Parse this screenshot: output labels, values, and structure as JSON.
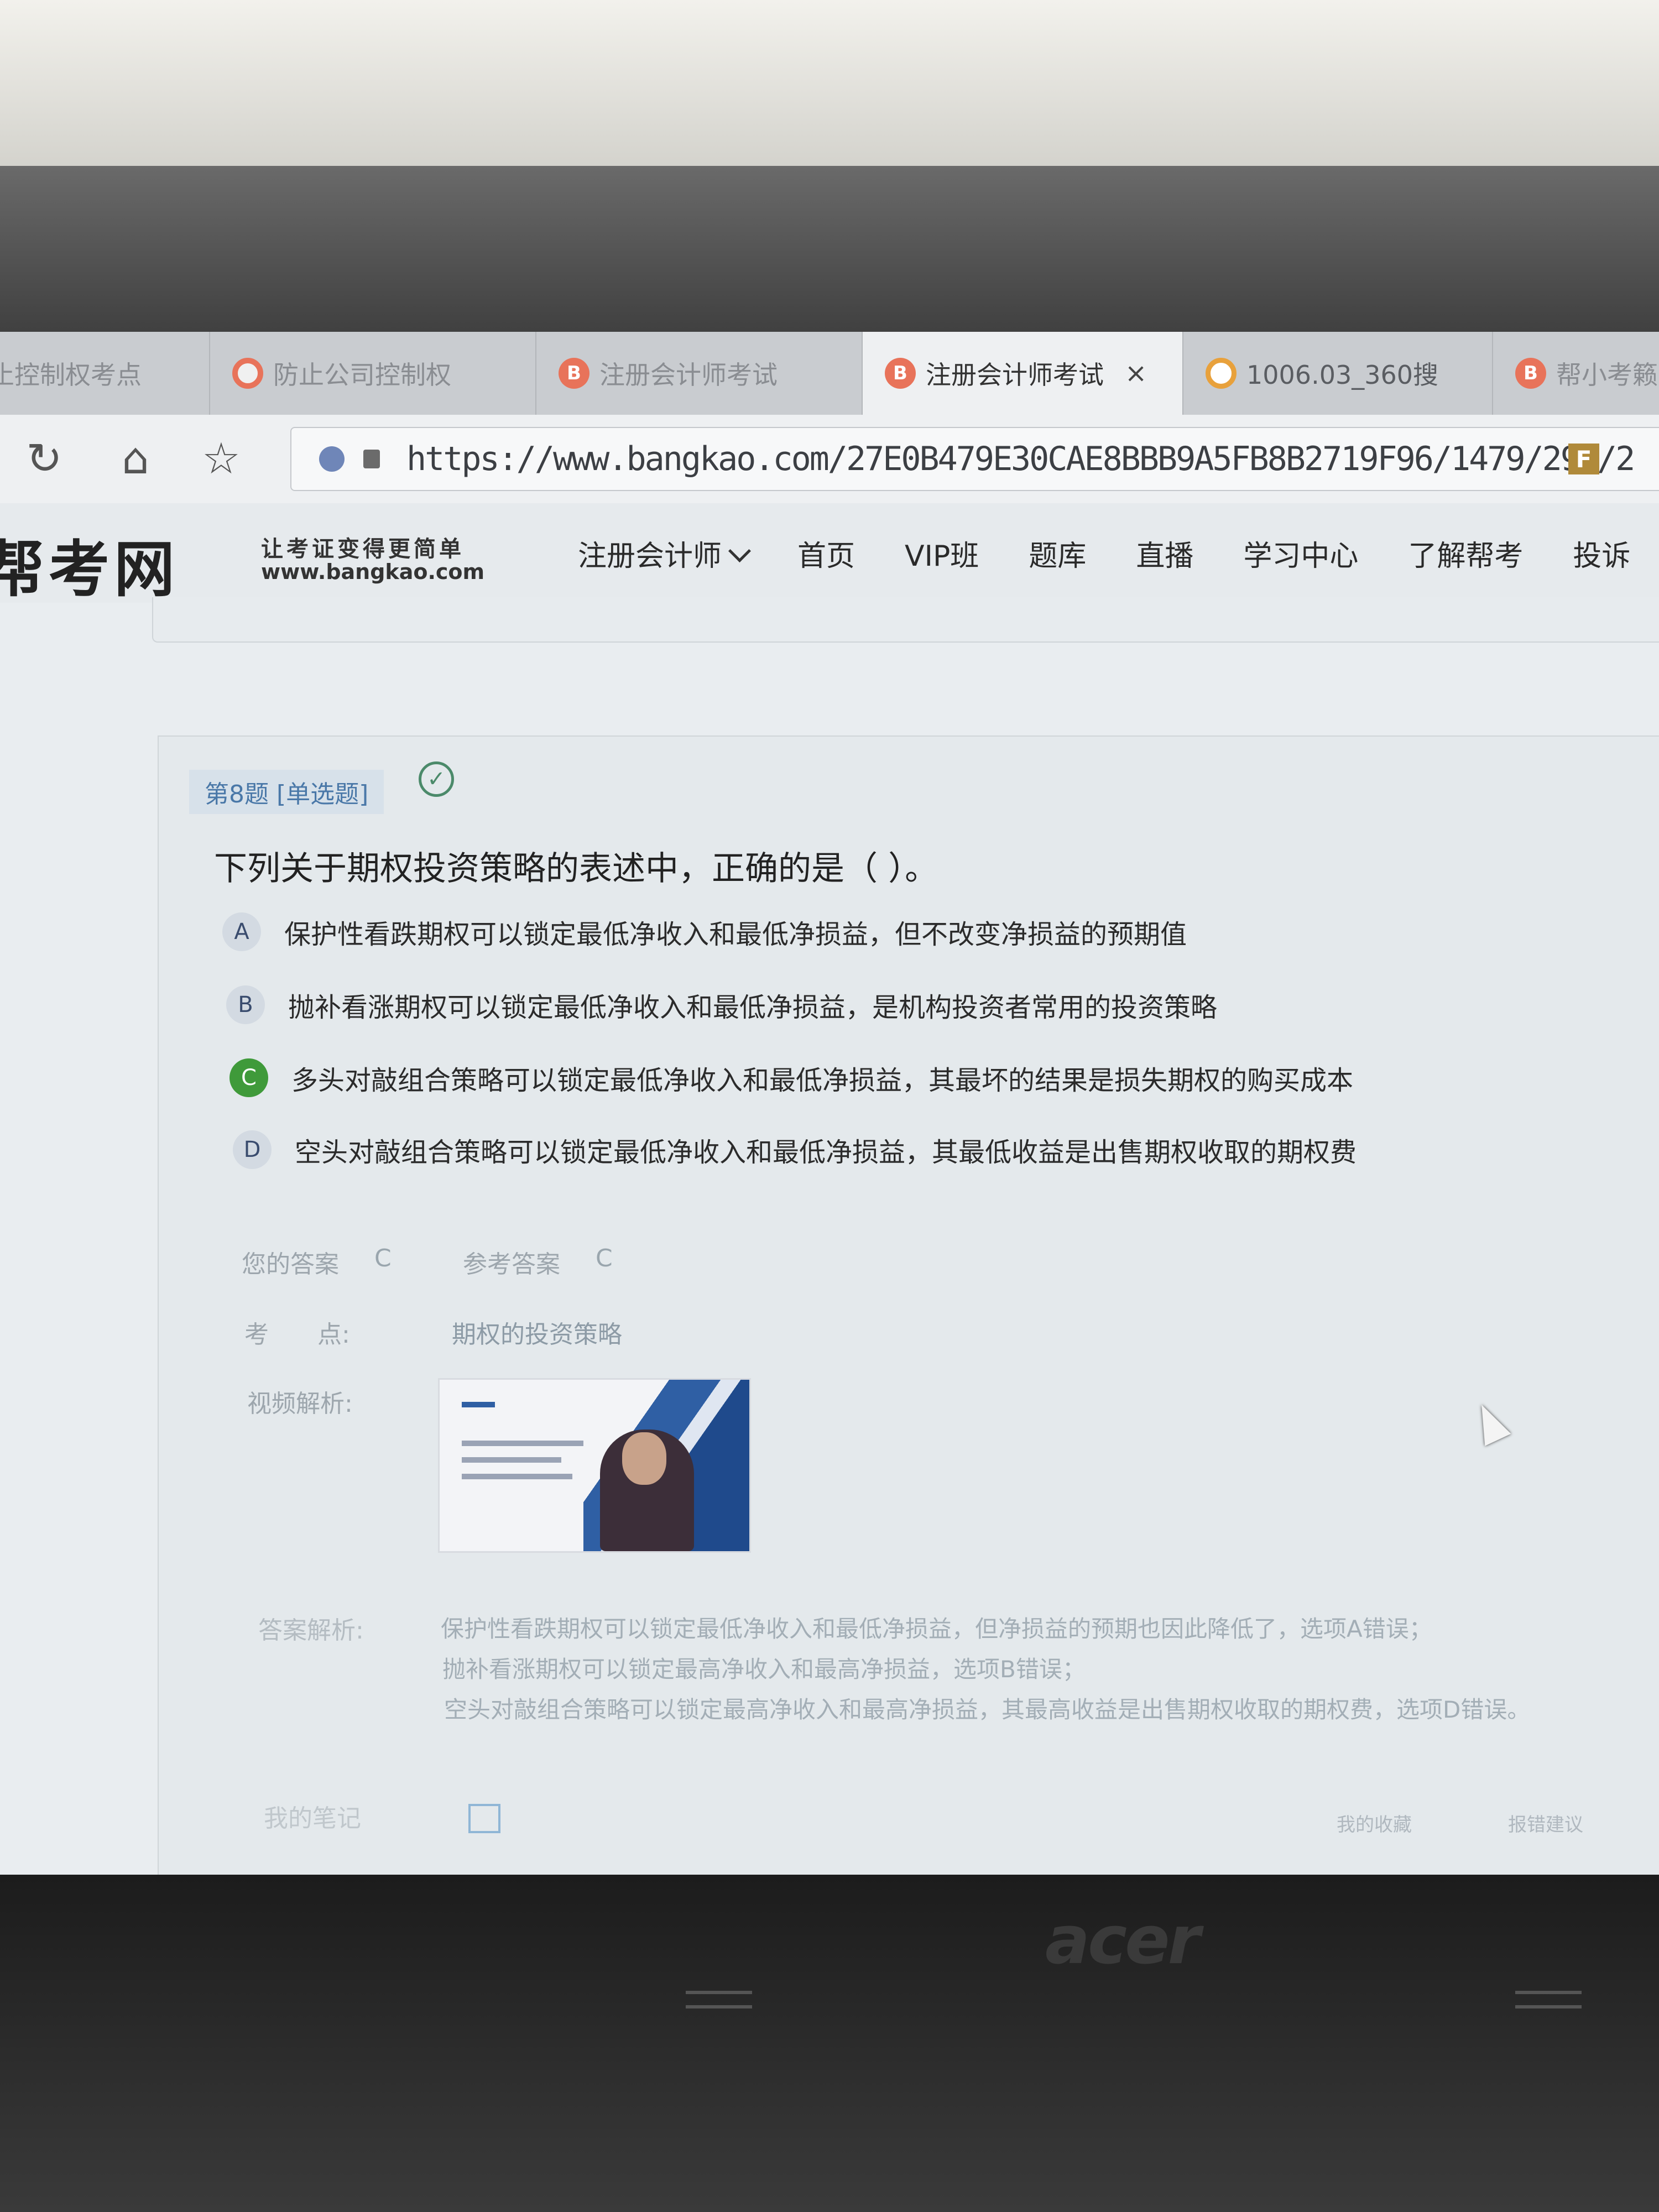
{
  "browser": {
    "tabs": [
      {
        "label": "止控制权考点",
        "icon": "none"
      },
      {
        "label": "防止公司控制权",
        "icon": "ring"
      },
      {
        "label": "注册会计师考试",
        "icon": "b"
      },
      {
        "label": "注册会计师考试",
        "icon": "b",
        "active": true
      },
      {
        "label": "1006.03_360搜",
        "icon": "search"
      },
      {
        "label": "帮小考籁",
        "icon": "b"
      }
    ],
    "close_symbol": "×",
    "url": "https://www.bangkao.com/27E0B479E30CAE8BBB9A5FB8B2719F96/1479/293/2",
    "extension_label": "F",
    "icons": {
      "reload": "reload-icon",
      "home": "home-icon",
      "star": "bookmark-star-icon"
    }
  },
  "site": {
    "logo": "帮考网",
    "slogan": "让考证变得更简单",
    "domain": "www.bangkao.com",
    "nav": [
      "注册会计师",
      "首页",
      "VIP班",
      "题库",
      "直播",
      "学习中心",
      "了解帮考",
      "投诉"
    ]
  },
  "question": {
    "tag": "第8题 [单选题]",
    "status_icon": "check-circle-icon",
    "stem": "下列关于期权投资策略的表述中，正确的是（ ）。",
    "options": [
      {
        "letter": "A",
        "text": "保护性看跌期权可以锁定最低净收入和最低净损益，但不改变净损益的预期值"
      },
      {
        "letter": "B",
        "text": "抛补看涨期权可以锁定最低净收入和最低净损益，是机构投资者常用的投资策略"
      },
      {
        "letter": "C",
        "text": "多头对敲组合策略可以锁定最低净收入和最低净损益，其最坏的结果是损失期权的购买成本",
        "selected": true
      },
      {
        "letter": "D",
        "text": "空头对敲组合策略可以锁定最低净收入和最低净损益，其最低收益是出售期权收取的期权费"
      }
    ],
    "your_answer_label": "您的答案",
    "your_answer": "C",
    "ref_answer_label": "参考答案",
    "ref_answer": "C",
    "point_label": "考　　点:",
    "point": "期权的投资策略",
    "video_label": "视频解析:",
    "analysis_label": "答案解析:",
    "analysis": [
      "保护性看跌期权可以锁定最低净收入和最低净损益，但净损益的预期也因此降低了，选项A错误；",
      "抛补看涨期权可以锁定最高净收入和最高净损益，选项B错误；",
      "空头对敲组合策略可以锁定最高净收入和最高净损益，其最高收益是出售期权收取的期权费，选项D错误。"
    ],
    "notes_label": "我的笔记",
    "footer_links": [
      "我的收藏",
      "报错建议"
    ]
  },
  "laptop": {
    "brand": "acer"
  }
}
